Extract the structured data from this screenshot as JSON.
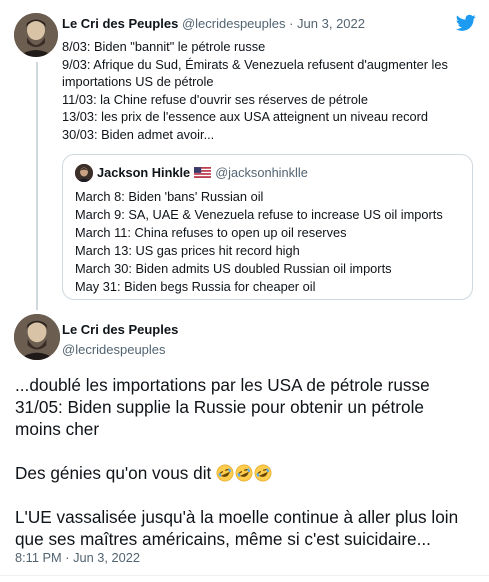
{
  "brand": {
    "accent": "#1d9bf0",
    "text": "#0f1419",
    "muted": "#536471",
    "border": "#cfd9de"
  },
  "tweet1": {
    "name": "Le Cri des Peuples",
    "handle": "@lecridespeuples",
    "dot": " · ",
    "date": "Jun 3, 2022",
    "lines": [
      "8/03: Biden \"bannit\" le pétrole russe",
      "9/03: Afrique du Sud, Émirats & Venezuela refusent d'augmenter les",
      "importations US de pétrole",
      "11/03: la Chine refuse d'ouvrir ses réserves de pétrole",
      "13/03: les prix de l'essence aux USA atteignent un niveau record",
      "30/03: Biden admet avoir..."
    ]
  },
  "quoted": {
    "name": "Jackson Hinkle",
    "flag_icon": "us-flag-icon",
    "handle": "@jacksonhinklle",
    "lines": [
      "March 8: Biden 'bans' Russian oil",
      "March 9: SA, UAE & Venezuela refuse to increase US oil imports",
      "March 11: China refuses to open up oil reserves",
      "March 13: US gas prices hit record high",
      "March 30: Biden admits US doubled Russian oil imports",
      "May 31: Biden begs Russia for cheaper oil"
    ]
  },
  "tweet2": {
    "name": "Le Cri des Peuples",
    "handle": "@lecridespeuples",
    "para1": [
      "...doublé les importations par les USA de pétrole russe",
      "31/05: Biden supplie la Russie pour obtenir un pétrole",
      "moins cher"
    ],
    "para2": "Des génies qu'on vous dit ",
    "emoji_icon": "rolling-on-floor-laughing-emoji",
    "emoji_count": 3,
    "para3": [
      "L'UE vassalisée jusqu'à la moelle continue à aller plus loin",
      "que ses maîtres américains, même si c'est suicidaire..."
    ],
    "time": "8:11 PM · Jun 3, 2022"
  }
}
